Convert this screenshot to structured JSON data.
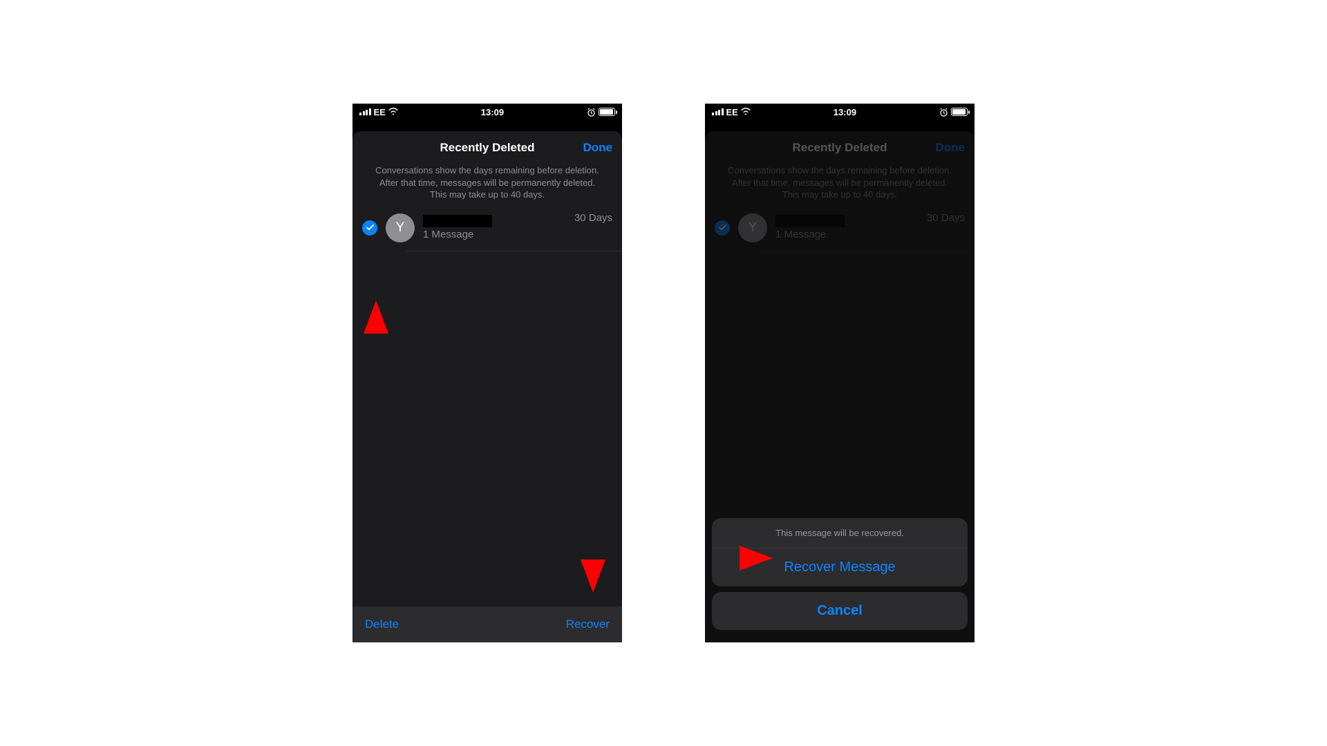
{
  "status": {
    "carrier": "EE",
    "time": "13:09"
  },
  "sheet": {
    "title": "Recently Deleted",
    "done": "Done",
    "explainer": "Conversations show the days remaining before deletion. After that time, messages will be permanently deleted. This may take up to 40 days."
  },
  "row": {
    "avatar_initial": "Y",
    "subtitle": "1 Message",
    "days": "30 Days"
  },
  "toolbar": {
    "delete": "Delete",
    "recover": "Recover"
  },
  "actionsheet": {
    "caption": "This message will be recovered.",
    "recover": "Recover Message",
    "cancel": "Cancel"
  }
}
